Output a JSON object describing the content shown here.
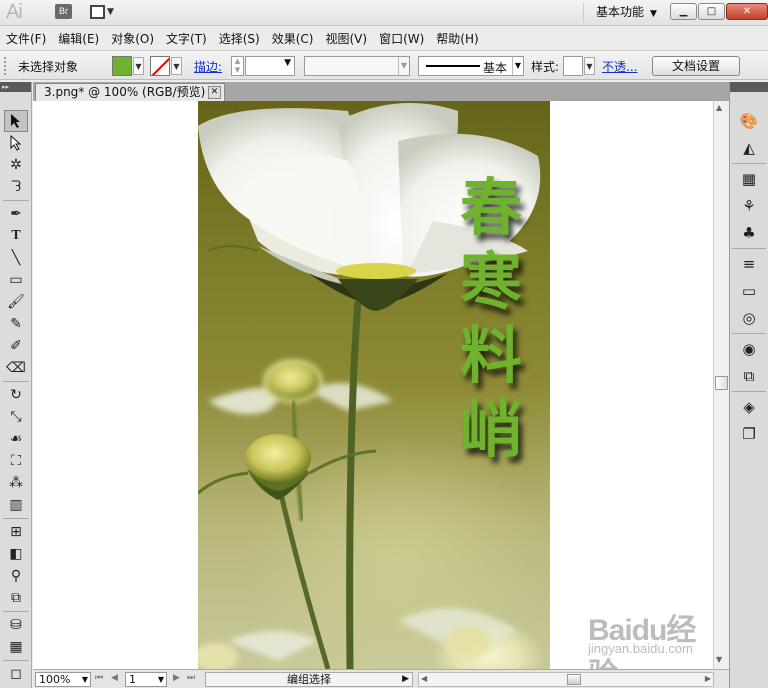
{
  "titlebar": {
    "app_logo": "Ai",
    "bridge_label": "Br",
    "workspace_label": "基本功能",
    "win_min": "▁",
    "win_max": "□",
    "win_close": "✕"
  },
  "menubar": {
    "items": [
      "文件(F)",
      "编辑(E)",
      "对象(O)",
      "文字(T)",
      "选择(S)",
      "效果(C)",
      "视图(V)",
      "窗口(W)",
      "帮助(H)"
    ]
  },
  "controlbar": {
    "selection_status": "未选择对象",
    "fill_color": "#6fb22d",
    "stroke_link": "描边:",
    "stroke_profile": "基本",
    "style_label": "样式:",
    "opacity_link": "不透...",
    "doc_setup_button": "文档设置"
  },
  "document": {
    "tab_title": "3.png* @ 100% (RGB/预览)",
    "tab_close": "✕",
    "artwork_text": [
      "春",
      "寒",
      "料",
      "峭"
    ],
    "text_color": "#6fb22d"
  },
  "statusbar": {
    "zoom": "100%",
    "artboard_number": "1",
    "status_text": "编组选择"
  },
  "tools": {
    "panel_grip": "▸▸",
    "icons": [
      "selection-tool-icon",
      "direct-selection-tool-icon",
      "magic-wand-tool-icon",
      "lasso-tool-icon",
      "pen-tool-icon",
      "type-tool-icon",
      "line-segment-tool-icon",
      "rectangle-tool-icon",
      "paintbrush-tool-icon",
      "pencil-tool-icon",
      "blob-brush-tool-icon",
      "eraser-tool-icon",
      "rotate-tool-icon",
      "scale-tool-icon",
      "warp-tool-icon",
      "free-transform-tool-icon",
      "symbol-sprayer-tool-icon",
      "column-graph-tool-icon",
      "mesh-tool-icon",
      "gradient-tool-icon",
      "eyedropper-tool-icon",
      "blend-tool-icon",
      "live-paint-bucket-tool-icon",
      "live-paint-selection-tool-icon",
      "artboard-tool-icon",
      "slice-tool-icon"
    ]
  },
  "right_panels": {
    "icons": [
      "color-panel-icon",
      "color-guide-panel-icon",
      "swatches-panel-icon",
      "brushes-panel-icon",
      "symbols-panel-icon",
      "stroke-panel-icon",
      "gradient-panel-icon",
      "transparency-panel-icon",
      "appearance-panel-icon",
      "graphic-styles-panel-icon",
      "layers-panel-icon",
      "artboards-panel-icon"
    ]
  },
  "watermark": {
    "main": "Baidu经验",
    "sub": "jingyan.baidu.com"
  }
}
